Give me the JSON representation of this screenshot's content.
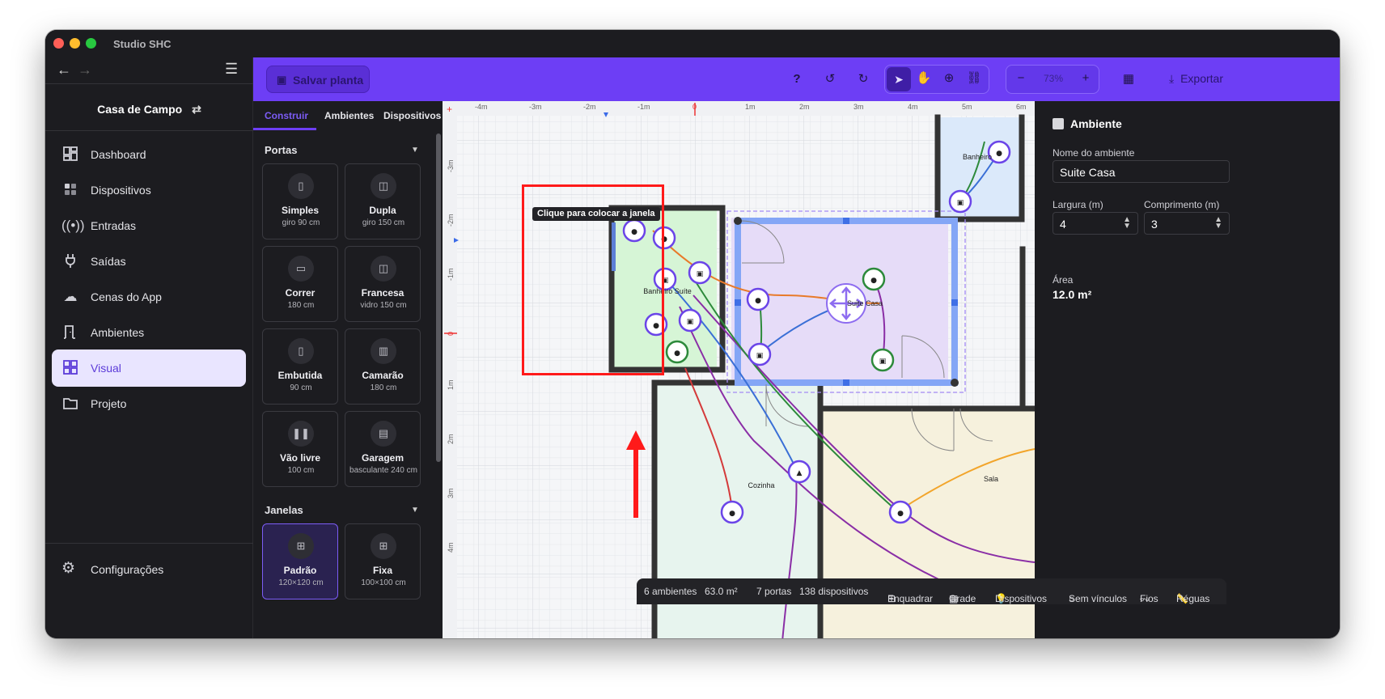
{
  "window": {
    "title": "Studio SHC"
  },
  "sidebar": {
    "project_name": "Casa de Campo",
    "items": [
      {
        "label": "Dashboard",
        "icon": "dashboard-icon"
      },
      {
        "label": "Dispositivos",
        "icon": "devices-icon"
      },
      {
        "label": "Entradas",
        "icon": "radio-waves-icon"
      },
      {
        "label": "Saídas",
        "icon": "plug-icon"
      },
      {
        "label": "Cenas do App",
        "icon": "cloud-icon"
      },
      {
        "label": "Ambientes",
        "icon": "door-icon"
      },
      {
        "label": "Visual",
        "icon": "visual-grid-icon",
        "active": true
      },
      {
        "label": "Projeto",
        "icon": "folder-icon"
      }
    ],
    "settings_label": "Configurações"
  },
  "toolbar": {
    "save_label": "Salvar planta",
    "zoom": "73%",
    "export_label": "Exportar"
  },
  "palette": {
    "tabs": [
      "Construir",
      "Ambientes",
      "Dispositivos"
    ],
    "active_tab": "Construir",
    "doors_title": "Portas",
    "doors": [
      {
        "name": "Simples",
        "sub": "giro 90 cm",
        "icon": "door-single-icon"
      },
      {
        "name": "Dupla",
        "sub": "giro 150 cm",
        "icon": "door-double-icon"
      },
      {
        "name": "Correr",
        "sub": "180 cm",
        "icon": "door-sliding-icon"
      },
      {
        "name": "Francesa",
        "sub": "vidro 150 cm",
        "icon": "door-french-icon"
      },
      {
        "name": "Embutida",
        "sub": "90 cm",
        "icon": "door-pocket-icon"
      },
      {
        "name": "Camarão",
        "sub": "180 cm",
        "icon": "door-folding-icon"
      },
      {
        "name": "Vão livre",
        "sub": "100 cm",
        "icon": "opening-icon"
      },
      {
        "name": "Garagem",
        "sub": "basculante 240 cm",
        "icon": "garage-door-icon"
      }
    ],
    "windows_title": "Janelas",
    "windows": [
      {
        "name": "Padrão",
        "sub": "120×120 cm",
        "icon": "window-icon",
        "selected": true
      },
      {
        "name": "Fixa",
        "sub": "100×100 cm",
        "icon": "window-fixed-icon"
      }
    ]
  },
  "canvas": {
    "ruler_x": [
      "-4m",
      "-3m",
      "-2m",
      "-1m",
      "0",
      "1m",
      "2m",
      "3m",
      "4m",
      "5m",
      "6m"
    ],
    "ruler_y": [
      "-3m",
      "-2m",
      "-1m",
      "0",
      "1m",
      "2m",
      "3m",
      "4m"
    ],
    "tooltip": "Clique para colocar a janela",
    "rooms": [
      "Banheiro Suíte",
      "Suite Casa",
      "Banheiro",
      "Cozinha",
      "Sala"
    ]
  },
  "inspector": {
    "title": "Ambiente",
    "name_label": "Nome do ambiente",
    "name_value": "Suite Casa",
    "width_label": "Largura (m)",
    "width_value": "4",
    "length_label": "Comprimento (m)",
    "length_value": "3",
    "area_label": "Área",
    "area_value": "12.0 m²"
  },
  "status": {
    "rooms": "6 ambientes",
    "area": "63.0 m²",
    "doors": "7 portas",
    "devices": "138 dispositivos",
    "toggles": [
      "Enquadrar",
      "Grade",
      "Dispositivos",
      "Sem vínculos",
      "Fios",
      "Réguas"
    ]
  },
  "colors": {
    "accent": "#6d3ef5",
    "annotation": "#ff1a1a"
  }
}
